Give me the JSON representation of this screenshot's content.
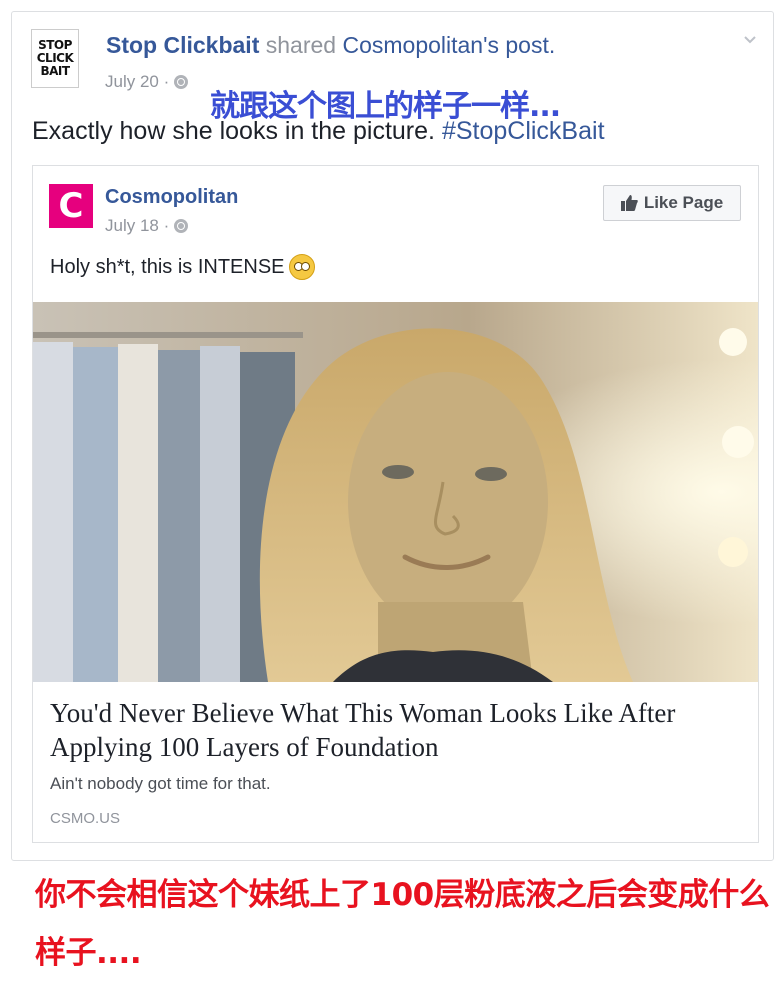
{
  "outer_post": {
    "logo_lines": [
      "STOP",
      "CLICK",
      "BAIT"
    ],
    "actor": "Stop Clickbait",
    "verb": "shared",
    "target": "Cosmopolitan",
    "suffix": "'s post.",
    "date": "July 20 ·",
    "caption_text": "Exactly how she looks in the picture.",
    "caption_hashtag": "#StopClickBait"
  },
  "overlay": {
    "top": "就跟这个图上的样子一样...",
    "bottom": "你不会相信这个妹纸上了100层粉底液之后会变成什么样子...."
  },
  "shared_post": {
    "logo_letter": "C",
    "page_name": "Cosmopolitan",
    "date": "July 18 ·",
    "like_label": "Like Page",
    "text": "Holy sh*t, this is INTENSE",
    "article": {
      "title": "You'd Never Believe What This Woman Looks Like After Applying 100 Layers of Foundation",
      "description": "Ain't nobody got time for that.",
      "domain": "CSMO.US"
    }
  },
  "icons": [
    "globe-icon",
    "chevron-down-icon",
    "thumbs-up-icon",
    "flushed-face-emoji"
  ],
  "colors": {
    "link": "#365899",
    "meta": "#90949c",
    "brand_cosmo": "#e6007e",
    "overlay_blue": "#3a4ed4",
    "overlay_red": "#e8121f"
  }
}
